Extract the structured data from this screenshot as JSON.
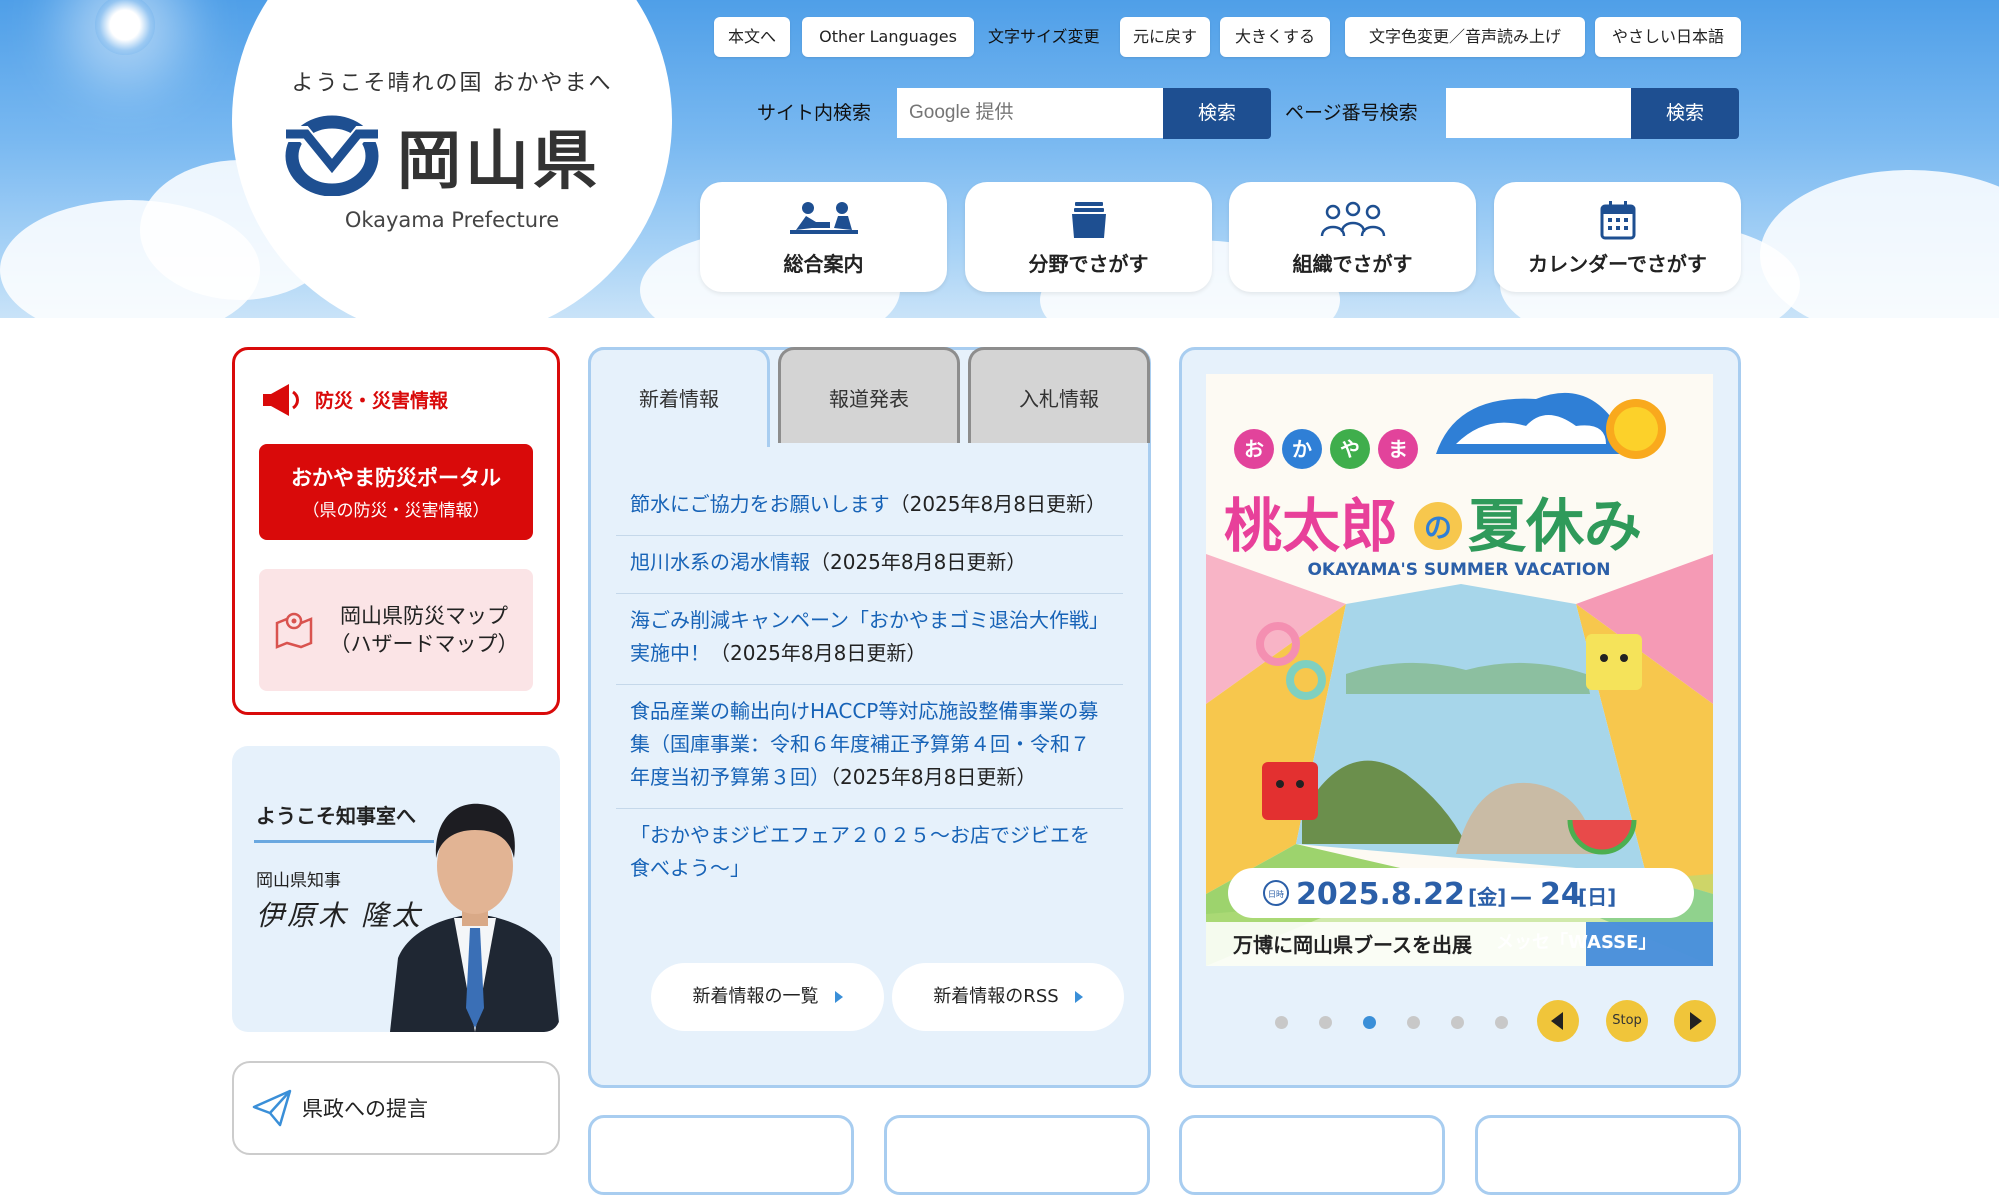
{
  "header": {
    "tagline": "ようこそ晴れの国 おかやまへ",
    "logo_name": "岡山県",
    "logo_en": "Okayama Prefecture",
    "tools": {
      "skip": "本文へ",
      "languages": "Other Languages",
      "font_size_label": "文字サイズ変更",
      "reset": "元に戻す",
      "larger": "大きくする",
      "color_voice": "文字色変更／音声読み上げ",
      "easy_japanese": "やさしい日本語"
    },
    "site_search": {
      "label": "サイト内検索",
      "placeholder": "Google 提供",
      "button": "検索"
    },
    "page_search": {
      "label": "ページ番号検索",
      "placeholder": "",
      "button": "検索"
    },
    "nav": [
      {
        "label": "総合案内",
        "icon": "people-desk-icon"
      },
      {
        "label": "分野でさがす",
        "icon": "folder-icon"
      },
      {
        "label": "組織でさがす",
        "icon": "organization-icon"
      },
      {
        "label": "カレンダーでさがす",
        "icon": "calendar-icon"
      }
    ]
  },
  "disaster": {
    "title": "防災・災害情報",
    "portal_main": "おかやま防災ポータル",
    "portal_sub": "（県の防災・災害情報）",
    "map": "岡山県防災マップ\n（ハザードマップ）"
  },
  "governor": {
    "title": "ようこそ知事室へ",
    "role": "岡山県知事",
    "signature": "伊原木 隆太"
  },
  "proposal": "県政への提言",
  "news": {
    "tabs": [
      "新着情報",
      "報道発表",
      "入札情報"
    ],
    "items": [
      {
        "link": "節水にご協力をお願いします",
        "date": "（2025年8月8日更新）"
      },
      {
        "link": "旭川水系の渇水情報",
        "date": "（2025年8月8日更新）"
      },
      {
        "link": "海ごみ削減キャンペーン「おかやまゴミ退治大作戦」実施中！",
        "date": "（2025年8月8日更新）"
      },
      {
        "link": "食品産業の輸出向けHACCP等対応施設整備事業の募集（国庫事業：令和６年度補正予算第４回・令和７年度当初予算第３回）",
        "date": "（2025年8月8日更新）"
      },
      {
        "link": "「おかやまジビエフェア２０２５～お店でジビエを食べよう～」",
        "date": ""
      }
    ],
    "list_button": "新着情報の一覧",
    "rss_button": "新着情報のRSS"
  },
  "banner": {
    "hiragana": [
      "お",
      "か",
      "や",
      "ま"
    ],
    "title_a": "桃太郎",
    "title_b": "の",
    "title_c": "夏休み",
    "subtitle": "OKAYAMA'S SUMMER VACATION",
    "date_text": "2025.8.22",
    "day1": "[金]",
    "dash": "—",
    "end_day": "24",
    "day2": "[日]",
    "date_badge": "日時",
    "caption": "万博に岡山県ブースを出展",
    "caption_tail": "メッセ「WASSE」",
    "dots": 6,
    "active_dot": 2,
    "stop_label": "Stop"
  },
  "colors": {
    "brand_blue": "#1e4f91",
    "disaster_red": "#d90a0a",
    "link_blue": "#1763b7",
    "panel_blue": "#e6f1fb",
    "control_yellow": "#f0c53a"
  }
}
